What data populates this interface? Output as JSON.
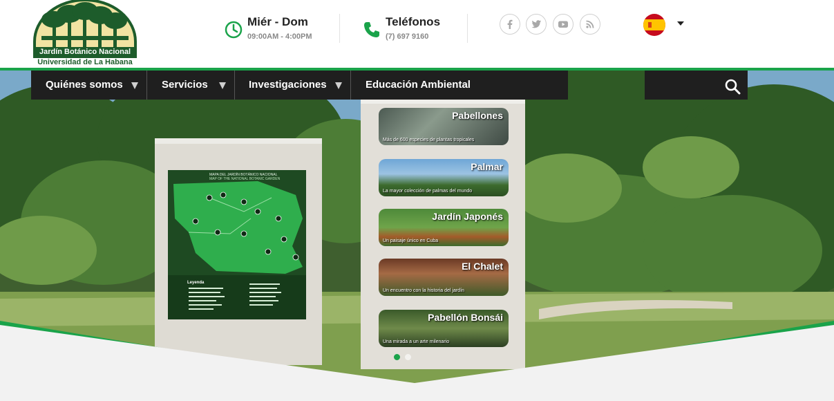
{
  "logo": {
    "line1": "Jardín Botánico Nacional",
    "line2": "Universidad de La Habana"
  },
  "hours": {
    "title": "Miér - Dom",
    "detail": "09:00AM - 4:00PM",
    "icon": "clock-icon"
  },
  "phone": {
    "title": "Teléfonos",
    "detail": "(7) 697 9160",
    "icon": "phone-icon"
  },
  "social": [
    {
      "name": "facebook-icon"
    },
    {
      "name": "twitter-icon"
    },
    {
      "name": "youtube-icon"
    },
    {
      "name": "rss-icon"
    }
  ],
  "language": {
    "flag": "spain-flag-icon"
  },
  "nav": {
    "items": [
      {
        "label": "Quiénes somos",
        "has_dropdown": true
      },
      {
        "label": "Servicios",
        "has_dropdown": true
      },
      {
        "label": "Investigaciones",
        "has_dropdown": true
      },
      {
        "label": "Educación Ambiental",
        "has_dropdown": false
      }
    ],
    "search_icon": "search-icon"
  },
  "hero": {
    "map": {
      "title": "MAPA DEL JARDÍN BOTÁNICO NACIONAL",
      "subtitle": "MAP OF THE NATIONAL BOTANIC GARDEN",
      "legend": "Leyenda"
    },
    "signs": [
      {
        "title": "Pabellones",
        "subtitle": "Más de 600 especies de plantas tropicales"
      },
      {
        "title": "Palmar",
        "subtitle": "La mayor colección de palmas del mundo"
      },
      {
        "title": "Jardín Japonés",
        "subtitle": "Un paisaje único en Cuba"
      },
      {
        "title": "El Chalet",
        "subtitle": "Un encuentro con la historia del jardín"
      },
      {
        "title": "Pabellón Bonsái",
        "subtitle": "Una mirada a un arte milenario"
      }
    ],
    "slider_dots": 2,
    "active_dot": 1
  },
  "colors": {
    "accent": "#1aa34a",
    "nav_bg": "#1f1f1f",
    "logo_green": "#1d5c2b"
  }
}
